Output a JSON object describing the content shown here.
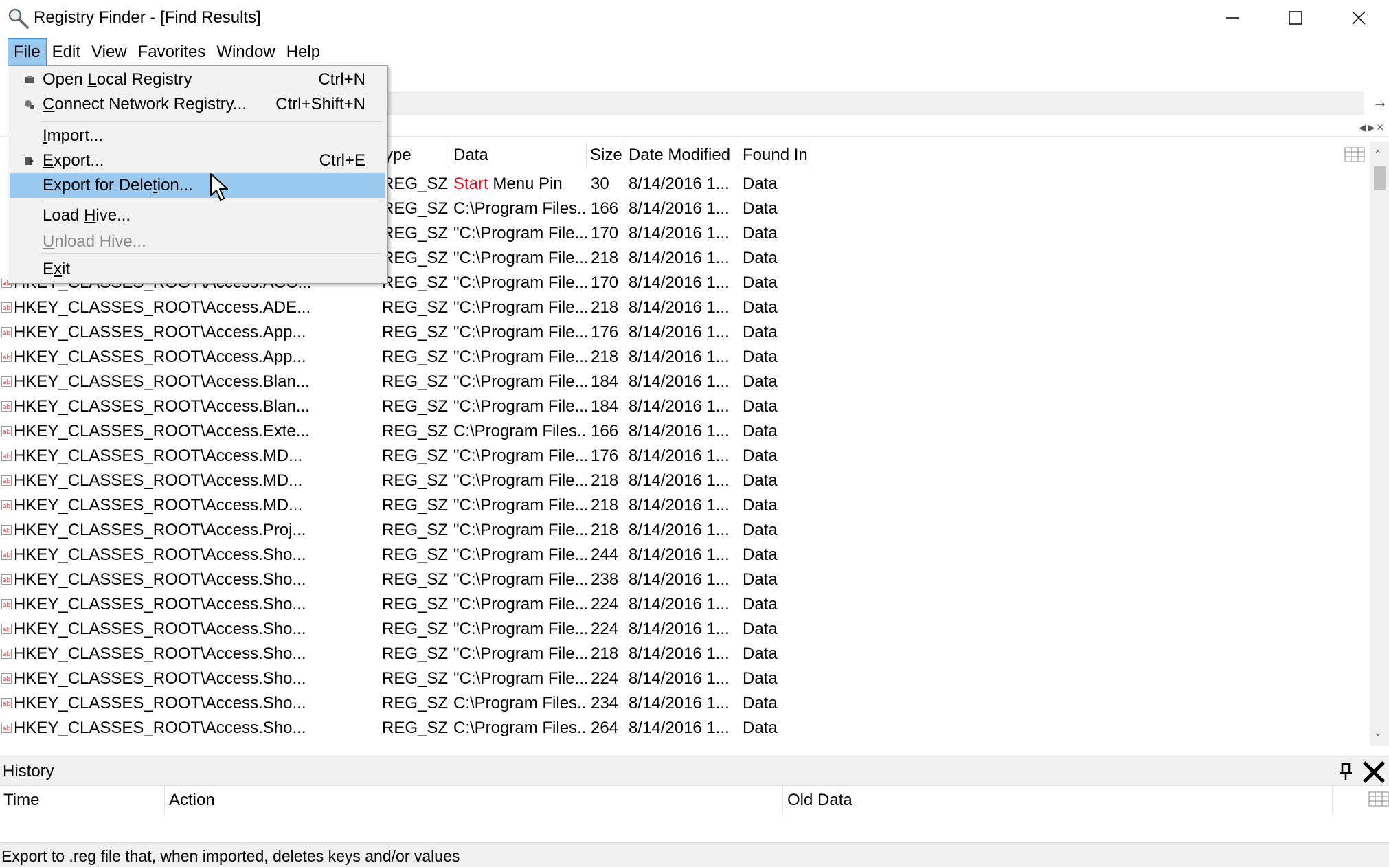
{
  "window": {
    "title": "Registry Finder - [Find Results]",
    "controls": {
      "minimize": "minimize-icon",
      "maximize": "maximize-icon",
      "close": "close-icon"
    }
  },
  "menubar": {
    "items": [
      "File",
      "Edit",
      "View",
      "Favorites",
      "Window",
      "Help"
    ],
    "active": "File"
  },
  "file_menu": {
    "items": [
      {
        "label": "Open Local Registry",
        "mnemonic": "L",
        "shortcut": "Ctrl+N",
        "icon": "local-registry-icon"
      },
      {
        "label": "Connect Network Registry...",
        "mnemonic": "C",
        "shortcut": "Ctrl+Shift+N",
        "icon": "network-registry-icon"
      },
      {
        "label": "Import...",
        "mnemonic": "I",
        "shortcut": ""
      },
      {
        "label": "Export...",
        "mnemonic": "E",
        "shortcut": "Ctrl+E",
        "icon": "export-icon"
      },
      {
        "label": "Export for Deletion...",
        "mnemonic": "t",
        "shortcut": "",
        "selected": true
      },
      {
        "label": "Load Hive...",
        "mnemonic": "H",
        "shortcut": ""
      },
      {
        "label": "Unload Hive...",
        "mnemonic": "U",
        "shortcut": "",
        "disabled": true
      },
      {
        "label": "Exit",
        "mnemonic": "x",
        "shortcut": ""
      }
    ]
  },
  "results": {
    "columns": [
      "ype",
      "Data",
      "Size",
      "Date Modified",
      "Found In"
    ],
    "rows": [
      {
        "name": "",
        "type": "REG_SZ",
        "data_highlight": "Start",
        "data": " Menu Pin",
        "size": "30",
        "date": "8/14/2016 1...",
        "found": "Data"
      },
      {
        "name": "",
        "type": "REG_SZ",
        "data": "C:\\Program Files...",
        "size": "166",
        "date": "8/14/2016 1...",
        "found": "Data"
      },
      {
        "name": "",
        "type": "REG_SZ",
        "data": "\"C:\\Program File...",
        "size": "170",
        "date": "8/14/2016 1...",
        "found": "Data"
      },
      {
        "name": "",
        "type": "REG_SZ",
        "data": "\"C:\\Program File...",
        "size": "218",
        "date": "8/14/2016 1...",
        "found": "Data"
      },
      {
        "name": "HKEY_CLASSES_ROOT\\Access.ACC...",
        "type": "REG_SZ",
        "data": "\"C:\\Program File...",
        "size": "170",
        "date": "8/14/2016 1...",
        "found": "Data"
      },
      {
        "name": "HKEY_CLASSES_ROOT\\Access.ADE...",
        "type": "REG_SZ",
        "data": "\"C:\\Program File...",
        "size": "218",
        "date": "8/14/2016 1...",
        "found": "Data"
      },
      {
        "name": "HKEY_CLASSES_ROOT\\Access.App...",
        "type": "REG_SZ",
        "data": "\"C:\\Program File...",
        "size": "176",
        "date": "8/14/2016 1...",
        "found": "Data"
      },
      {
        "name": "HKEY_CLASSES_ROOT\\Access.App...",
        "type": "REG_SZ",
        "data": "\"C:\\Program File...",
        "size": "218",
        "date": "8/14/2016 1...",
        "found": "Data"
      },
      {
        "name": "HKEY_CLASSES_ROOT\\Access.Blan...",
        "type": "REG_SZ",
        "data": "\"C:\\Program File...",
        "size": "184",
        "date": "8/14/2016 1...",
        "found": "Data"
      },
      {
        "name": "HKEY_CLASSES_ROOT\\Access.Blan...",
        "type": "REG_SZ",
        "data": "\"C:\\Program File...",
        "size": "184",
        "date": "8/14/2016 1...",
        "found": "Data"
      },
      {
        "name": "HKEY_CLASSES_ROOT\\Access.Exte...",
        "type": "REG_SZ",
        "data": "C:\\Program Files...",
        "size": "166",
        "date": "8/14/2016 1...",
        "found": "Data"
      },
      {
        "name": "HKEY_CLASSES_ROOT\\Access.MD...",
        "type": "REG_SZ",
        "data": "\"C:\\Program File...",
        "size": "176",
        "date": "8/14/2016 1...",
        "found": "Data"
      },
      {
        "name": "HKEY_CLASSES_ROOT\\Access.MD...",
        "type": "REG_SZ",
        "data": "\"C:\\Program File...",
        "size": "218",
        "date": "8/14/2016 1...",
        "found": "Data"
      },
      {
        "name": "HKEY_CLASSES_ROOT\\Access.MD...",
        "type": "REG_SZ",
        "data": "\"C:\\Program File...",
        "size": "218",
        "date": "8/14/2016 1...",
        "found": "Data"
      },
      {
        "name": "HKEY_CLASSES_ROOT\\Access.Proj...",
        "type": "REG_SZ",
        "data": "\"C:\\Program File...",
        "size": "218",
        "date": "8/14/2016 1...",
        "found": "Data"
      },
      {
        "name": "HKEY_CLASSES_ROOT\\Access.Sho...",
        "type": "REG_SZ",
        "data": "\"C:\\Program File...",
        "size": "244",
        "date": "8/14/2016 1...",
        "found": "Data"
      },
      {
        "name": "HKEY_CLASSES_ROOT\\Access.Sho...",
        "type": "REG_SZ",
        "data": "\"C:\\Program File...",
        "size": "238",
        "date": "8/14/2016 1...",
        "found": "Data"
      },
      {
        "name": "HKEY_CLASSES_ROOT\\Access.Sho...",
        "type": "REG_SZ",
        "data": "\"C:\\Program File...",
        "size": "224",
        "date": "8/14/2016 1...",
        "found": "Data"
      },
      {
        "name": "HKEY_CLASSES_ROOT\\Access.Sho...",
        "type": "REG_SZ",
        "data": "\"C:\\Program File...",
        "size": "224",
        "date": "8/14/2016 1...",
        "found": "Data"
      },
      {
        "name": "HKEY_CLASSES_ROOT\\Access.Sho...",
        "type": "REG_SZ",
        "data": "\"C:\\Program File...",
        "size": "218",
        "date": "8/14/2016 1...",
        "found": "Data"
      },
      {
        "name": "HKEY_CLASSES_ROOT\\Access.Sho...",
        "type": "REG_SZ",
        "data": "\"C:\\Program File...",
        "size": "224",
        "date": "8/14/2016 1...",
        "found": "Data"
      },
      {
        "name": "HKEY_CLASSES_ROOT\\Access.Sho...",
        "type": "REG_SZ",
        "data": "C:\\Program Files...",
        "size": "234",
        "date": "8/14/2016 1...",
        "found": "Data"
      },
      {
        "name": "HKEY_CLASSES_ROOT\\Access.Sho...",
        "type": "REG_SZ",
        "data": "C:\\Program Files...",
        "size": "264",
        "date": "8/14/2016 1...",
        "found": "Data"
      }
    ]
  },
  "history": {
    "title": "History",
    "columns": [
      "Time",
      "Action",
      "Old Data"
    ]
  },
  "status": {
    "text": "Export to .reg file that, when imported, deletes keys and/or values"
  },
  "colors": {
    "menu_highlight": "#99c9ef",
    "menu_bg": "#f2f2f2",
    "accent_red": "#e81123",
    "panel_bg": "#f0f0f0",
    "disabled_text": "#8b8b8b"
  }
}
